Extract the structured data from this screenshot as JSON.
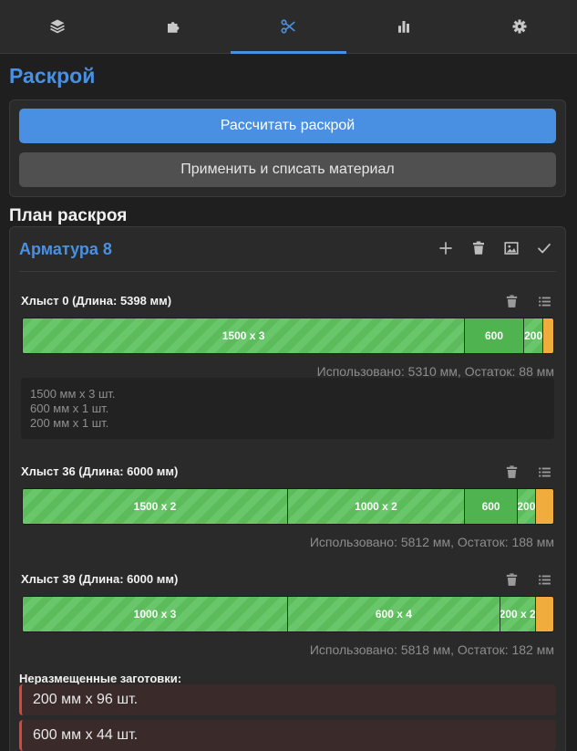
{
  "tabs": [
    {
      "name": "layers",
      "icon": "layers-icon"
    },
    {
      "name": "parts",
      "icon": "puzzle-icon"
    },
    {
      "name": "cutting",
      "icon": "scissors-icon",
      "active": true
    },
    {
      "name": "stats",
      "icon": "bar-chart-icon"
    },
    {
      "name": "settings",
      "icon": "gear-icon"
    }
  ],
  "page_title": "Раскрой",
  "actions": {
    "calculate_label": "Рассчитать раскрой",
    "apply_label": "Применить и списать материал"
  },
  "plan": {
    "title": "План раскроя",
    "material": {
      "name": "Арматура 8",
      "icons": [
        "plus-icon",
        "trash-icon",
        "image-icon",
        "check-icon"
      ]
    },
    "bars": [
      {
        "title": "Хлыст 0 (Длина: 5398 мм)",
        "length": 5398,
        "segments": [
          {
            "label": "1500 x 3",
            "length": 4500,
            "style": "striped"
          },
          {
            "label": "600",
            "length": 600,
            "style": "plain"
          },
          {
            "label": "200",
            "length": 200,
            "style": "striped"
          }
        ],
        "usage": "Использовано: 5310 мм, Остаток: 88 мм",
        "details": [
          "1500 мм x 3 шт.",
          "600 мм x 1 шт.",
          "200 мм x 1 шт."
        ]
      },
      {
        "title": "Хлыст 36 (Длина: 6000 мм)",
        "length": 6000,
        "segments": [
          {
            "label": "1500 x 2",
            "length": 3000,
            "style": "striped"
          },
          {
            "label": "1000 x 2",
            "length": 2000,
            "style": "striped"
          },
          {
            "label": "600",
            "length": 600,
            "style": "plain"
          },
          {
            "label": "200",
            "length": 200,
            "style": "striped"
          }
        ],
        "usage": "Использовано: 5812 мм, Остаток: 188 мм"
      },
      {
        "title": "Хлыст 39 (Длина: 6000 мм)",
        "length": 6000,
        "segments": [
          {
            "label": "1000 x 3",
            "length": 3000,
            "style": "striped"
          },
          {
            "label": "600 x 4",
            "length": 2400,
            "style": "striped"
          },
          {
            "label": "200 x 2",
            "length": 400,
            "style": "striped"
          }
        ],
        "usage": "Использовано: 5818 мм, Остаток: 182 мм"
      }
    ],
    "unplaced": {
      "title": "Неразмещенные заготовки:",
      "items": [
        "200 мм x 96 шт.",
        "600 мм x 44 шт."
      ]
    }
  },
  "colors": {
    "accent": "#4a90e2",
    "segment_green": "#5cbc5c",
    "remainder_orange": "#f0ad3e",
    "warning_red": "#d9443c"
  }
}
